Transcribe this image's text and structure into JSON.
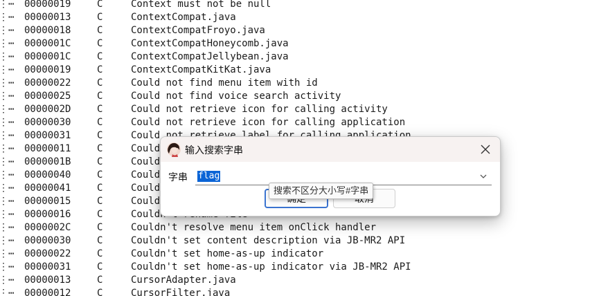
{
  "string_list": {
    "rows": [
      {
        "len": "00000019",
        "type": "C",
        "text": "Context must not be null"
      },
      {
        "len": "00000013",
        "type": "C",
        "text": "ContextCompat.java"
      },
      {
        "len": "00000018",
        "type": "C",
        "text": "ContextCompatFroyo.java"
      },
      {
        "len": "0000001C",
        "type": "C",
        "text": "ContextCompatHoneycomb.java"
      },
      {
        "len": "0000001C",
        "type": "C",
        "text": "ContextCompatJellybean.java"
      },
      {
        "len": "00000019",
        "type": "C",
        "text": "ContextCompatKitKat.java"
      },
      {
        "len": "00000022",
        "type": "C",
        "text": "Could not find menu item with id"
      },
      {
        "len": "00000025",
        "type": "C",
        "text": "Could not find voice search activity"
      },
      {
        "len": "0000002D",
        "type": "C",
        "text": "Could not retrieve icon for calling activity"
      },
      {
        "len": "00000030",
        "type": "C",
        "text": "Could not retrieve icon for calling application"
      },
      {
        "len": "00000031",
        "type": "C",
        "text": "Could not retrieve label for calling application"
      },
      {
        "len": "00000011",
        "type": "C",
        "text": "Could"
      },
      {
        "len": "0000001B",
        "type": "C",
        "text": "Could"
      },
      {
        "len": "00000040",
        "type": "C",
        "text": "Could                                              ght."
      },
      {
        "len": "00000041",
        "type": "C",
        "text": "Could                                              slow."
      },
      {
        "len": "00000015",
        "type": "C",
        "text": "Could"
      },
      {
        "len": "00000016",
        "type": "C",
        "text": "Couldn't rename file"
      },
      {
        "len": "0000002C",
        "type": "C",
        "text": "Couldn't resolve menu item onClick handler"
      },
      {
        "len": "00000030",
        "type": "C",
        "text": "Couldn't set content description via JB-MR2 API"
      },
      {
        "len": "00000022",
        "type": "C",
        "text": "Couldn't set home-as-up indicator"
      },
      {
        "len": "00000031",
        "type": "C",
        "text": "Couldn't set home-as-up indicator via JB-MR2 API"
      },
      {
        "len": "00000013",
        "type": "C",
        "text": "CursorAdapter.java"
      },
      {
        "len": "00000012",
        "type": "C",
        "text": "CursorFilter.java"
      }
    ],
    "dots": "⋮⋯"
  },
  "dialog": {
    "title": "输入搜索字串",
    "field_label": "字串",
    "input_value": "flag",
    "ok_label": "确定",
    "cancel_label": "取消",
    "tooltip": "搜索不区分大小写#字串"
  },
  "icons": {
    "app": "avatar-icon",
    "close": "close-icon",
    "dropdown": "chevron-down-icon"
  }
}
